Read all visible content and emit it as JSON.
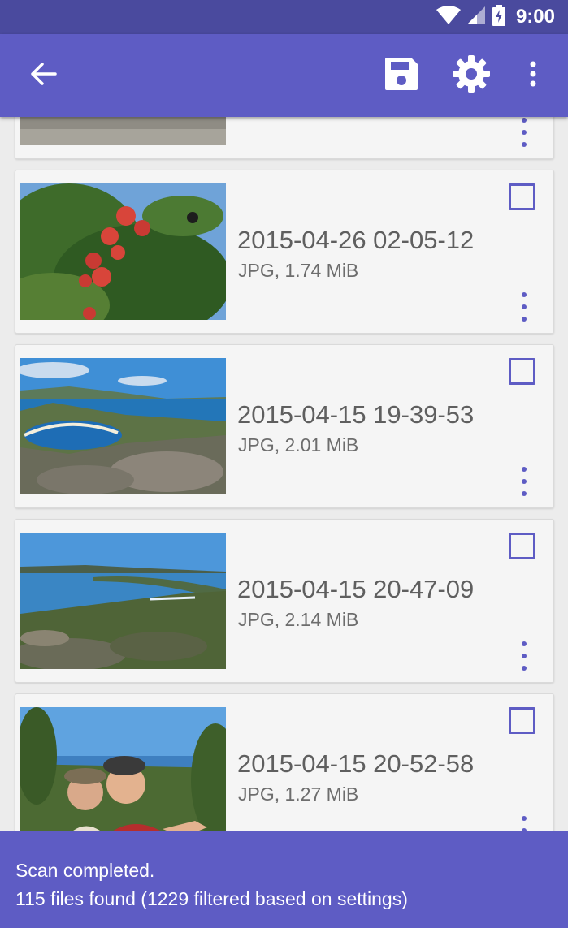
{
  "status_bar": {
    "time": "9:00"
  },
  "toolbar": {
    "back_icon": "arrow-back-icon",
    "save_icon": "save-icon",
    "settings_icon": "gear-icon",
    "overflow_icon": "more-vert-icon"
  },
  "files": [
    {
      "date": "",
      "meta": ""
    },
    {
      "date": "2015-04-26 02-05-12",
      "meta": "JPG, 1.74 MiB"
    },
    {
      "date": "2015-04-15 19-39-53",
      "meta": "JPG, 2.01 MiB"
    },
    {
      "date": "2015-04-15 20-47-09",
      "meta": "JPG, 2.14 MiB"
    },
    {
      "date": "2015-04-15 20-52-58",
      "meta": "JPG, 1.27 MiB"
    }
  ],
  "scan_status": {
    "line1": "Scan completed.",
    "line2": "115 files found (1229 filtered based on settings)"
  },
  "colors": {
    "primary": "#5e5cc4",
    "status_bar": "#4a4a9e",
    "card_bg": "#f5f5f5",
    "text_primary": "#5f5f5f"
  }
}
